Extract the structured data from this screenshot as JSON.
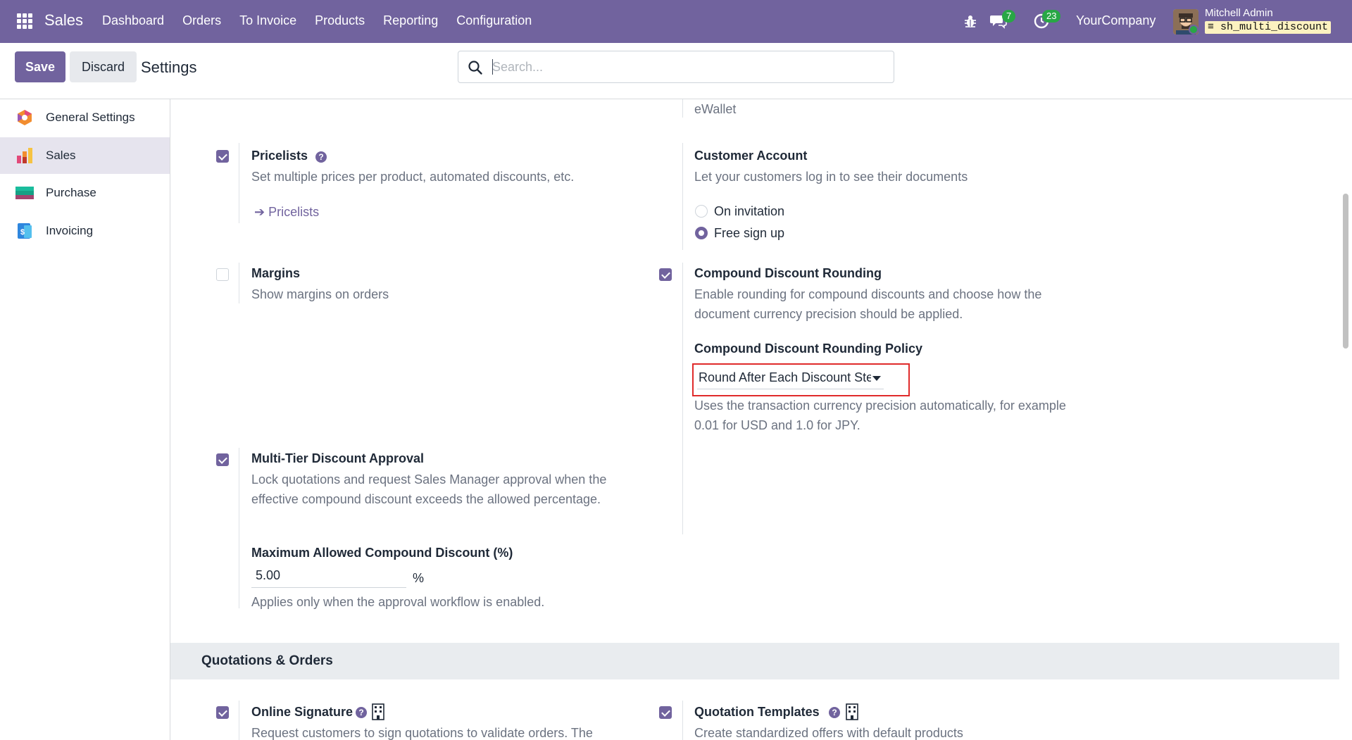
{
  "navbar": {
    "app_name": "Sales",
    "menu": [
      "Dashboard",
      "Orders",
      "To Invoice",
      "Products",
      "Reporting",
      "Configuration"
    ],
    "messages_count": "7",
    "activities_count": "23",
    "company": "YourCompany",
    "user_name": "Mitchell Admin",
    "database": "sh_multi_discount"
  },
  "control": {
    "save_label": "Save",
    "discard_label": "Discard",
    "breadcrumb": "Settings",
    "search_placeholder": "Search..."
  },
  "sidebar": {
    "items": [
      {
        "label": "General Settings",
        "icon": "general-settings-icon"
      },
      {
        "label": "Sales",
        "icon": "sales-icon",
        "active": true
      },
      {
        "label": "Purchase",
        "icon": "purchase-icon"
      },
      {
        "label": "Invoicing",
        "icon": "invoicing-icon"
      }
    ]
  },
  "content": {
    "ewallet_text": "eWallet",
    "pricelists": {
      "title": "Pricelists",
      "checked": true,
      "description": "Set multiple prices per product, automated discounts, etc.",
      "link": "Pricelists"
    },
    "customer_account": {
      "title": "Customer Account",
      "description": "Let your customers log in to see their documents",
      "options": [
        "On invitation",
        "Free sign up"
      ],
      "selected": "Free sign up"
    },
    "margins": {
      "title": "Margins",
      "checked": false,
      "description": "Show margins on orders"
    },
    "compound_rounding": {
      "title": "Compound Discount Rounding",
      "checked": true,
      "description": "Enable rounding for compound discounts and choose how the document currency precision should be applied.",
      "policy_label": "Compound Discount Rounding Policy",
      "policy_value": "Round After Each Discount Step",
      "policy_help": "Uses the transaction currency precision automatically, for example 0.01 for USD and 1.0 for JPY."
    },
    "multi_tier": {
      "title": "Multi-Tier Discount Approval",
      "checked": true,
      "description": "Lock quotations and request Sales Manager approval when the effective compound discount exceeds the allowed percentage.",
      "max_label": "Maximum Allowed Compound Discount (%)",
      "max_value": "5.00",
      "unit": "%",
      "help": "Applies only when the approval workflow is enabled."
    },
    "section_quotations": "Quotations & Orders",
    "online_signature": {
      "title": "Online Signature",
      "checked": true,
      "description": "Request customers to sign quotations to validate orders. The"
    },
    "quotation_templates": {
      "title": "Quotation Templates",
      "checked": true,
      "description": "Create standardized offers with default products"
    }
  },
  "colors": {
    "brand": "#71639e",
    "highlight_border": "#e02b2b",
    "badge": "#28a745"
  }
}
